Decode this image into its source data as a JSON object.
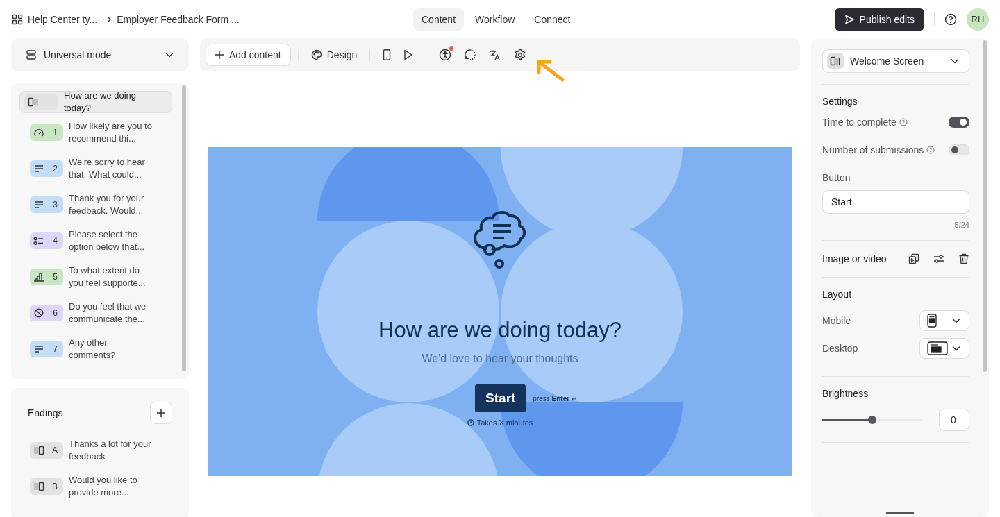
{
  "breadcrumb": [
    "Help Center ty...",
    "Employer Feedback Form ..."
  ],
  "tabs": [
    {
      "label": "Content",
      "selected": true
    },
    {
      "label": "Workflow",
      "selected": false
    },
    {
      "label": "Connect",
      "selected": false
    }
  ],
  "publish_button": "Publish edits",
  "avatar": "RH",
  "mode_select": "Universal mode",
  "toolbar": {
    "add_content": "Add content",
    "design": "Design",
    "accessibility_alert": true
  },
  "questions": [
    {
      "kind": "welcome",
      "text": "How are we doing today?",
      "selected": true
    },
    {
      "kind": "rating",
      "number": "1",
      "text": "How likely are you to recommend thi...",
      "selected": false
    },
    {
      "kind": "text",
      "number": "2",
      "text": "We're sorry to hear that. What could...",
      "selected": false
    },
    {
      "kind": "text",
      "number": "3",
      "text": "Thank you for your feedback. Would...",
      "selected": false
    },
    {
      "kind": "choice",
      "number": "4",
      "text": "Please select the option below that...",
      "selected": false
    },
    {
      "kind": "scale",
      "number": "5",
      "text": "To what extent do you feel supporte...",
      "selected": false
    },
    {
      "kind": "yesno",
      "number": "6",
      "text": "Do you feel that we communicate the...",
      "selected": false
    },
    {
      "kind": "text",
      "number": "7",
      "text": "Any other comments?",
      "selected": false
    }
  ],
  "endings": {
    "title": "Endings",
    "items": [
      {
        "letter": "A",
        "text": "Thanks a lot for your feedback"
      },
      {
        "letter": "B",
        "text": "Would you like to provide more..."
      }
    ]
  },
  "preview": {
    "title": "How are we doing today?",
    "subtitle": "We'd love to hear your thoughts",
    "button": "Start",
    "hint": "press **Enter** ↵",
    "time": "Takes X minutes"
  },
  "panel": {
    "screen_select": "Welcome Screen",
    "settings_title": "Settings",
    "toggles": [
      {
        "label": "Time to complete",
        "on": true
      },
      {
        "label": "Number of submissions",
        "on": false
      }
    ],
    "button_label": "Button",
    "button_value": "Start",
    "counter": "5/24",
    "media_label": "Image or video",
    "layout_title": "Layout",
    "layout": [
      {
        "label": "Mobile"
      },
      {
        "label": "Desktop"
      }
    ],
    "brightness_title": "Brightness",
    "brightness": {
      "level": 0.5,
      "value": "0"
    }
  }
}
